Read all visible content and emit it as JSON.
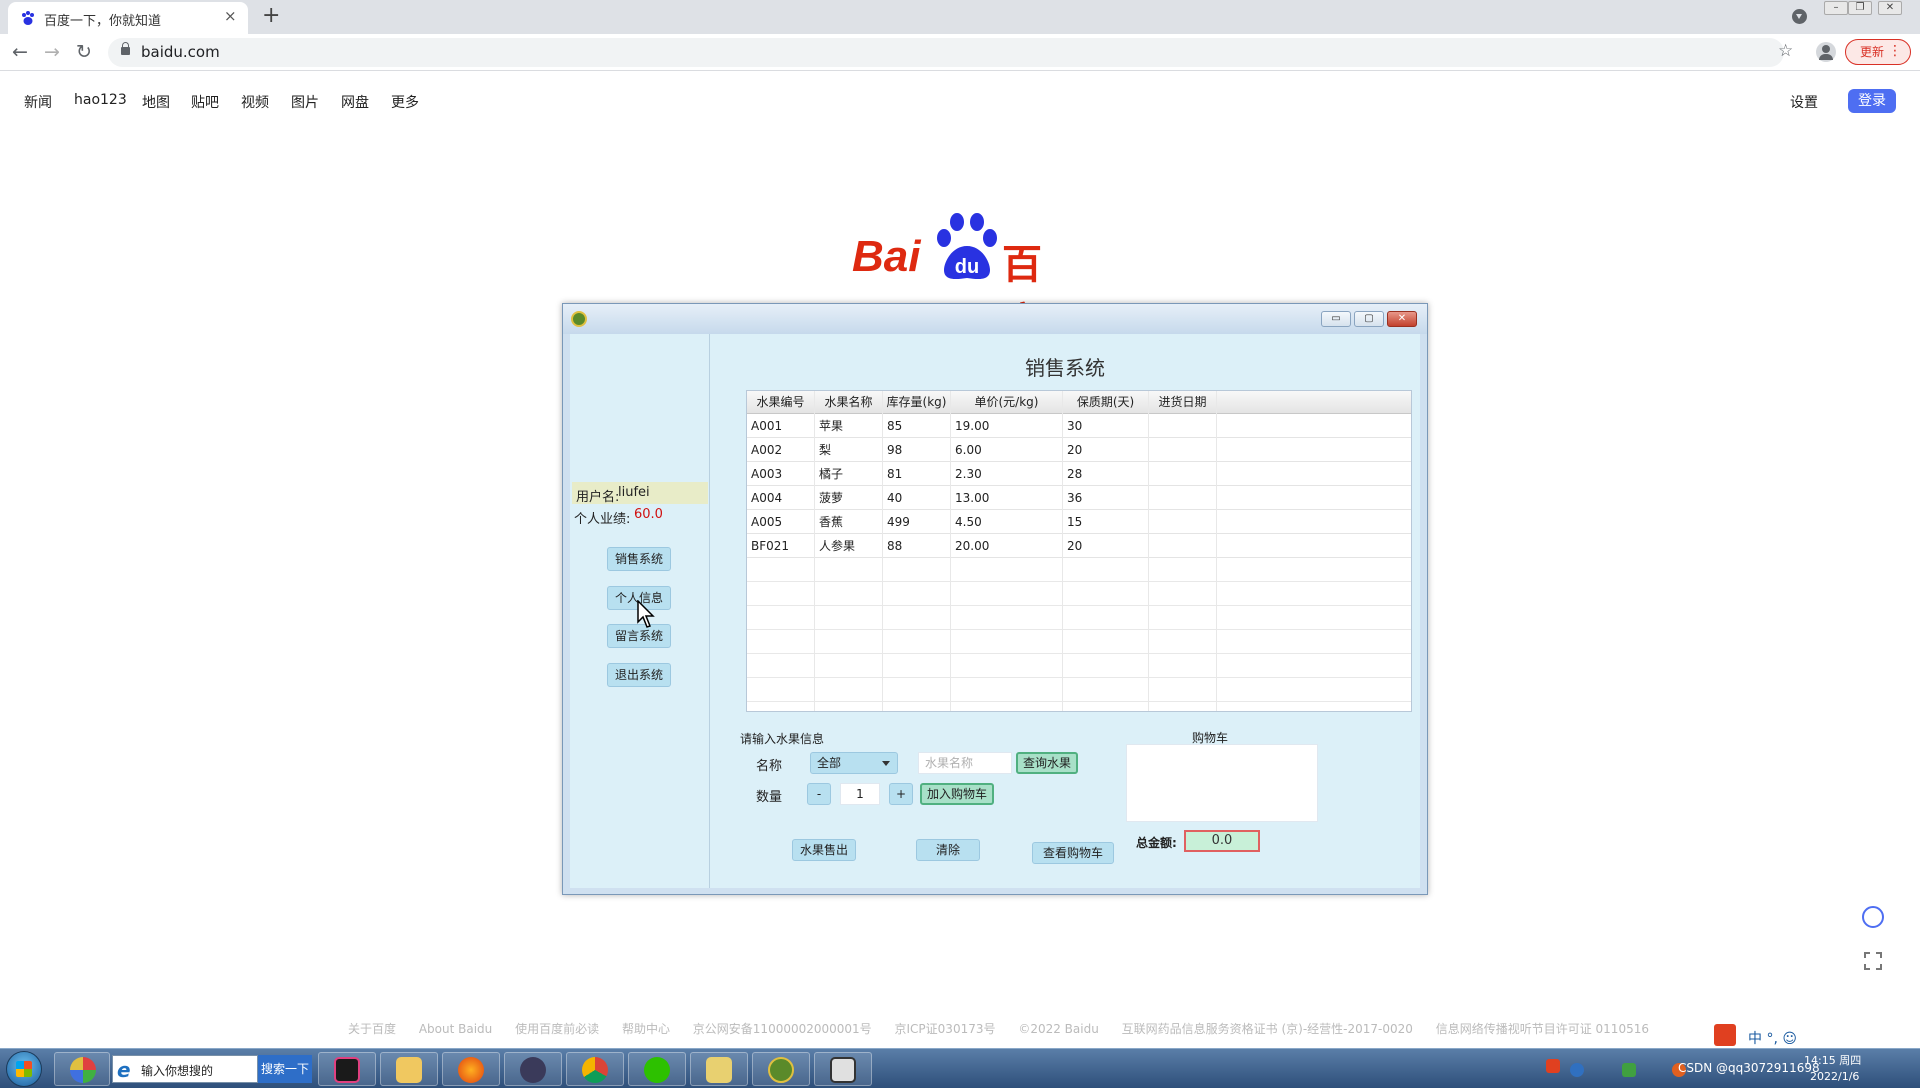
{
  "browser": {
    "tab_title": "百度一下，你就知道",
    "tab_close": "×",
    "new_tab": "+",
    "url": "baidu.com",
    "nav_back": "←",
    "nav_forward": "→",
    "nav_reload": "↻",
    "bookmark_star": "☆",
    "update_label": "更新",
    "update_dots": "⋮",
    "window_minimize": "–",
    "window_restore": "❐",
    "window_close": "✕"
  },
  "baidu": {
    "topnav": [
      "新闻",
      "hao123",
      "地图",
      "贴吧",
      "视频",
      "图片",
      "网盘",
      "更多"
    ],
    "settings": "设置",
    "login": "登录",
    "logo_latin_left": "Bai",
    "logo_latin_inner": "du",
    "logo_cn": "百度",
    "footer": [
      "关于百度",
      "About Baidu",
      "使用百度前必读",
      "帮助中心",
      "京公网安备11000002000001号",
      "京ICP证030173号",
      "©2022 Baidu",
      "互联网药品信息服务资格证书 (京)-经营性-2017-0020",
      "信息网络传播视听节目许可证 0110516"
    ]
  },
  "app": {
    "window_controls": {
      "minimize": "▭",
      "maximize": "▢",
      "close": "✕"
    },
    "sidebar": {
      "user_label": "用户名:",
      "user_name": "liufei",
      "perf_label": "个人业绩:",
      "perf_value": "60.0",
      "buttons": [
        "销售系统",
        "个人信息",
        "留言系统",
        "退出系统"
      ]
    },
    "title": "销售系统",
    "table": {
      "columns": [
        "水果编号",
        "水果名称",
        "库存量(kg)",
        "单价(元/kg)",
        "保质期(天)",
        "进货日期"
      ],
      "rows": [
        [
          "A001",
          "苹果",
          "85",
          "19.00",
          "30",
          ""
        ],
        [
          "A002",
          "梨",
          "98",
          "6.00",
          "20",
          ""
        ],
        [
          "A003",
          "橘子",
          "81",
          "2.30",
          "28",
          ""
        ],
        [
          "A004",
          "菠萝",
          "40",
          "13.00",
          "36",
          ""
        ],
        [
          "A005",
          "香蕉",
          "499",
          "4.50",
          "15",
          ""
        ],
        [
          "BF021",
          "人参果",
          "88",
          "20.00",
          "20",
          ""
        ]
      ]
    },
    "form": {
      "caption": "请输入水果信息",
      "name_label": "名称",
      "name_select": "全部",
      "name_placeholder": "水果名称",
      "query_button": "查询水果",
      "qty_label": "数量",
      "minus": "-",
      "qty_value": "1",
      "plus": "+",
      "add_cart_button": "加入购物车",
      "sell_button": "水果售出",
      "clear_button": "清除",
      "view_cart_button": "查看购物车"
    },
    "cart": {
      "label": "购物车",
      "total_label": "总金额:",
      "total_value": "0.0"
    }
  },
  "taskbar": {
    "search_text": "输入你想搜的",
    "search_button": "搜索一下",
    "tray_ime": "中 °, ☺",
    "tray_watermark": "CSDN @qq3072911698",
    "clock_time": "14:15 周四",
    "clock_date": "2022/1/6"
  }
}
